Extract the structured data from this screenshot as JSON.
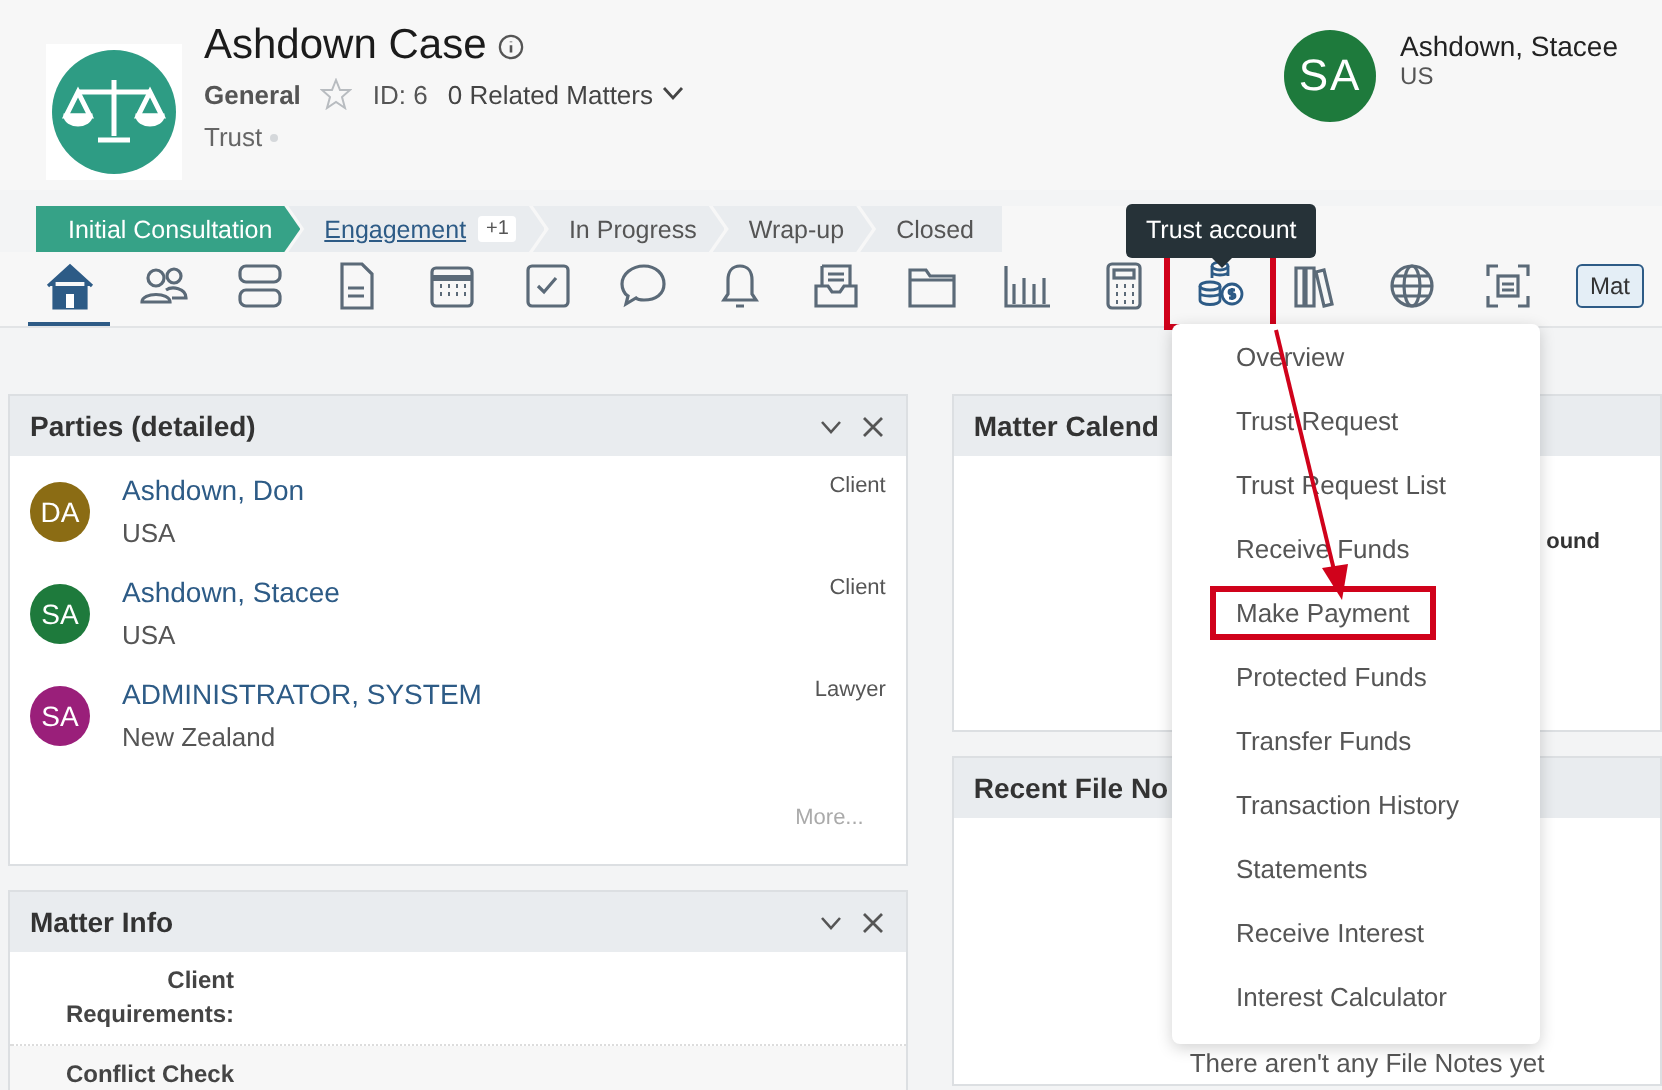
{
  "matter": {
    "title": "Ashdown Case",
    "type": "General",
    "starred": false,
    "id": "ID: 6",
    "related": "0 Related Matters",
    "account": "Trust"
  },
  "client": {
    "initials": "SA",
    "name": "Ashdown, Stacee",
    "country": "US",
    "color": "#1e7a3c"
  },
  "stages": [
    {
      "label": "Initial Consultation",
      "selected": true,
      "link": false
    },
    {
      "label": "Engagement",
      "selected": false,
      "link": true,
      "badge": "+1"
    },
    {
      "label": "In Progress",
      "selected": false,
      "link": false
    },
    {
      "label": "Wrap-up",
      "selected": false,
      "link": false
    },
    {
      "label": "Closed",
      "selected": false,
      "link": false
    }
  ],
  "nav": [
    {
      "kind": "home",
      "selected": true,
      "highlighted": false
    },
    {
      "kind": "people",
      "selected": false,
      "highlighted": false
    },
    {
      "kind": "cards",
      "selected": false,
      "highlighted": false
    },
    {
      "kind": "document",
      "selected": false,
      "highlighted": false
    },
    {
      "kind": "calendar",
      "selected": false,
      "highlighted": false
    },
    {
      "kind": "checkbox",
      "selected": false,
      "highlighted": false
    },
    {
      "kind": "chat",
      "selected": false,
      "highlighted": false
    },
    {
      "kind": "bell",
      "selected": false,
      "highlighted": false
    },
    {
      "kind": "inbox",
      "selected": false,
      "highlighted": false
    },
    {
      "kind": "folder",
      "selected": false,
      "highlighted": false
    },
    {
      "kind": "chart",
      "selected": false,
      "highlighted": false
    },
    {
      "kind": "calculator",
      "selected": false,
      "highlighted": false
    },
    {
      "kind": "coins",
      "selected": false,
      "highlighted": true
    },
    {
      "kind": "books",
      "selected": false,
      "highlighted": false
    },
    {
      "kind": "globe",
      "selected": false,
      "highlighted": false
    },
    {
      "kind": "scan",
      "selected": false,
      "highlighted": false
    }
  ],
  "nav_button": "Mat",
  "tooltip": "Trust account",
  "parties": {
    "title": "Parties (detailed)",
    "more": "More...",
    "items": [
      {
        "initials": "DA",
        "color": "#8b6c14",
        "name": "Ashdown, Don",
        "country": "USA",
        "role": "Client"
      },
      {
        "initials": "SA",
        "color": "#1e7a3c",
        "name": "Ashdown, Stacee",
        "country": "USA",
        "role": "Client"
      },
      {
        "initials": "SA",
        "color": "#9a1f7a",
        "name": "ADMINISTRATOR, SYSTEM",
        "country": "New Zealand",
        "role": "Lawyer"
      }
    ]
  },
  "matter_info": {
    "title": "Matter Info",
    "rows": [
      "Client Requirements:",
      "Conflict Check"
    ]
  },
  "calendar": {
    "title": "Matter Calend",
    "message": "ound"
  },
  "file_notes": {
    "title": "Recent File No",
    "message": "There aren't any File Notes yet"
  },
  "menu": [
    {
      "label": "Overview",
      "highlighted": false
    },
    {
      "label": "Trust Request",
      "highlighted": false
    },
    {
      "label": "Trust Request List",
      "highlighted": false
    },
    {
      "label": "Receive Funds",
      "highlighted": false
    },
    {
      "label": "Make Payment",
      "highlighted": true
    },
    {
      "label": "Protected Funds",
      "highlighted": false
    },
    {
      "label": "Transfer Funds",
      "highlighted": false
    },
    {
      "label": "Transaction History",
      "highlighted": false
    },
    {
      "label": "Statements",
      "highlighted": false
    },
    {
      "label": "Receive Interest",
      "highlighted": false
    },
    {
      "label": "Interest Calculator",
      "highlighted": false
    }
  ]
}
